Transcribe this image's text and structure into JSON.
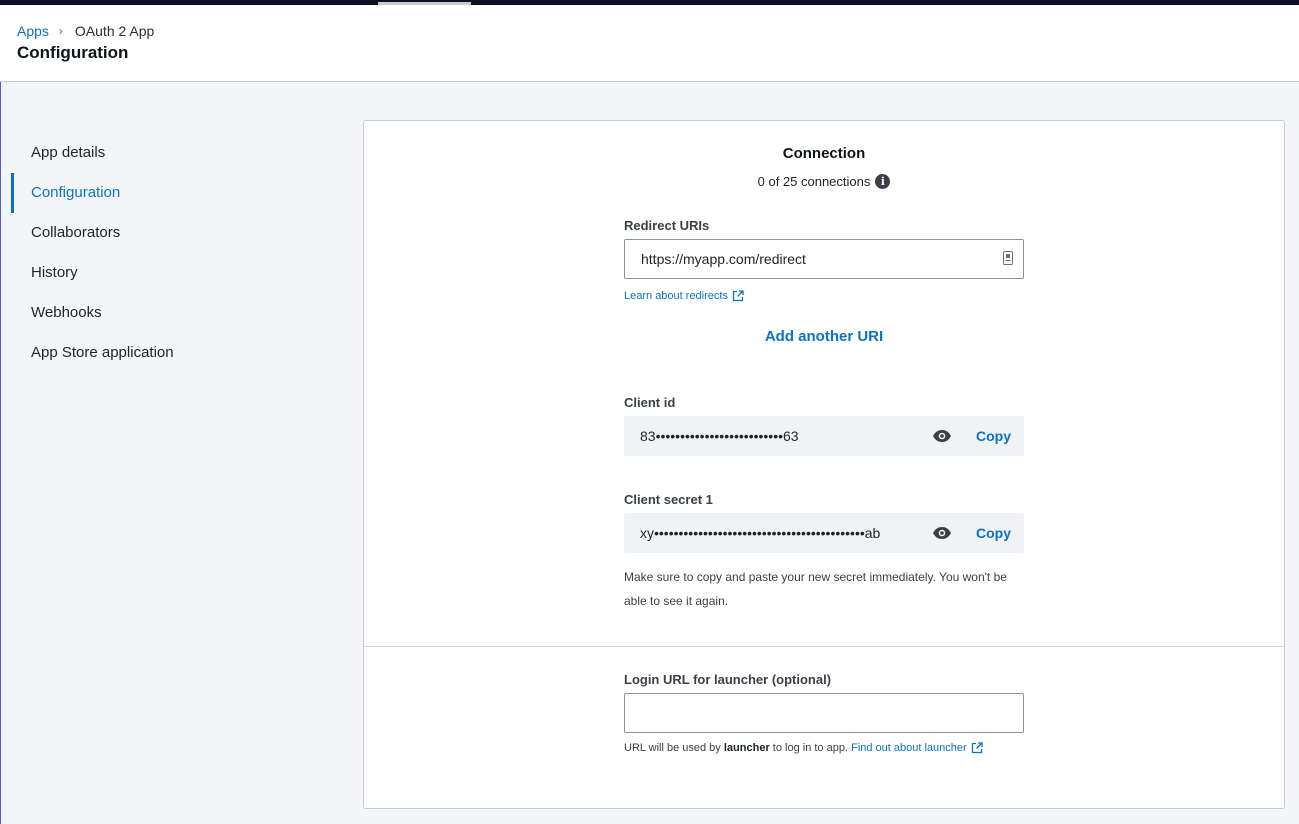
{
  "breadcrumb": {
    "apps": "Apps",
    "separator": "›",
    "current": "OAuth 2 App"
  },
  "page_title": "Configuration",
  "sidebar": {
    "items": [
      {
        "label": "App details"
      },
      {
        "label": "Configuration",
        "active": true
      },
      {
        "label": "Collaborators"
      },
      {
        "label": "History"
      },
      {
        "label": "Webhooks"
      },
      {
        "label": "App Store application"
      }
    ]
  },
  "connection": {
    "title": "Connection",
    "count": "0 of 25 connections",
    "info_icon": "i"
  },
  "redirect": {
    "label": "Redirect URIs",
    "value": "https://myapp.com/redirect",
    "learn_link": "Learn about redirects",
    "add_another": "Add another URI"
  },
  "client_id": {
    "label": "Client id",
    "value": "83••••••••••••••••••••••••••63",
    "copy": "Copy"
  },
  "client_secret": {
    "label": "Client secret 1",
    "value": "xy•••••••••••••••••••••••••••••••••••••••••••ab",
    "copy": "Copy",
    "note": "Make sure to copy and paste your new secret immediately. You won't be able to see it again."
  },
  "login_url": {
    "label": "Login URL for launcher (optional)",
    "value": "",
    "help_prefix": "URL will be used by",
    "help_bold": "launcher",
    "help_mid": "to log in to app.",
    "help_link": "Find out about launcher"
  },
  "colors": {
    "accent": "#0b73c2",
    "topbar": "#0b1022"
  }
}
